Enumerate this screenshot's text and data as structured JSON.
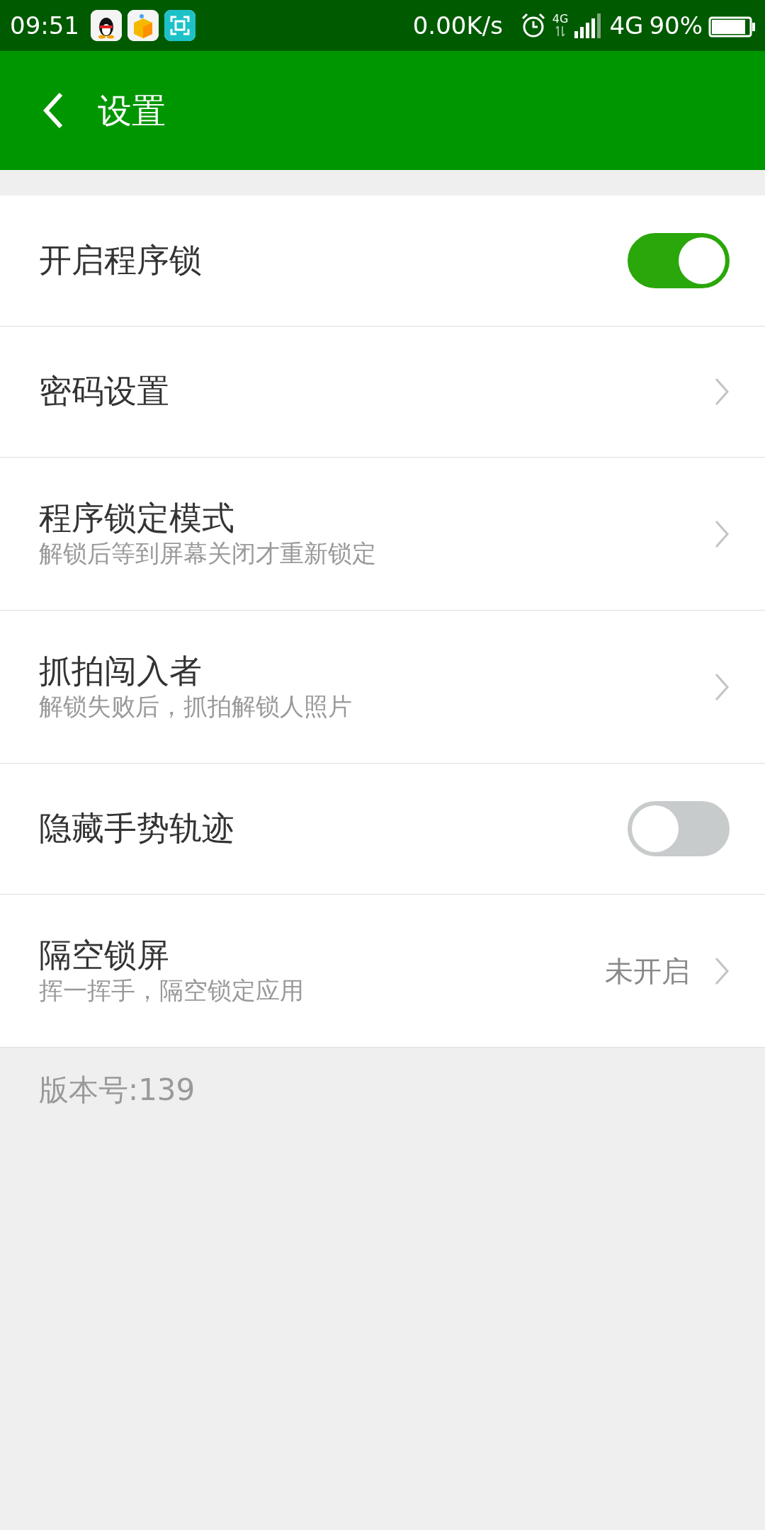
{
  "status_bar": {
    "time": "09:51",
    "speed": "0.00K/s",
    "network_small": "4G",
    "network": "4G",
    "battery": "90%"
  },
  "toolbar": {
    "title": "设置"
  },
  "items": [
    {
      "kind": "toggle",
      "title": "开启程序锁",
      "on": true
    },
    {
      "kind": "link",
      "title": "密码设置"
    },
    {
      "kind": "link",
      "title": "程序锁定模式",
      "subtitle": "解锁后等到屏幕关闭才重新锁定"
    },
    {
      "kind": "link",
      "title": "抓拍闯入者",
      "subtitle": "解锁失败后，抓拍解锁人照片"
    },
    {
      "kind": "toggle",
      "title": "隐藏手势轨迹",
      "on": false
    },
    {
      "kind": "link",
      "title": "隔空锁屏",
      "subtitle": "挥一挥手，隔空锁定应用",
      "value": "未开启"
    }
  ],
  "footer": {
    "version": "版本号:139"
  }
}
